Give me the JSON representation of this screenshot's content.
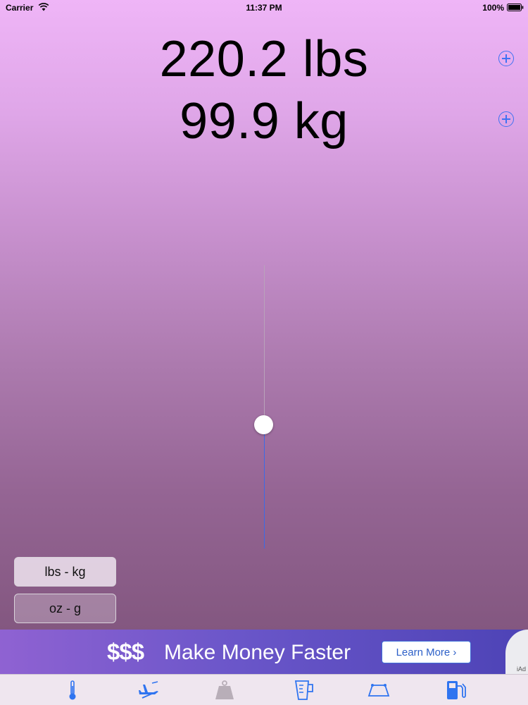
{
  "status_bar": {
    "carrier": "Carrier",
    "time": "11:37 PM",
    "battery": "100%"
  },
  "display": {
    "primary_value": "220.2 lbs",
    "secondary_value": "99.9 kg"
  },
  "slider": {
    "level_fraction": 0.43
  },
  "unit_buttons": {
    "lbs_kg": "lbs - kg",
    "oz_g": "oz - g"
  },
  "ad": {
    "logo": "$$$",
    "headline": "Make Money Faster",
    "cta": "Learn More ›",
    "label": "iAd"
  },
  "tab_bar": {
    "icons": [
      "thermometer-icon",
      "airplane-icon",
      "weight-icon",
      "measuring-cup-icon",
      "area-icon",
      "fuel-pump-icon"
    ],
    "selected": "weight-icon",
    "accent": "#2f74f0",
    "inactive": "#b8aeb8"
  },
  "colors": {
    "accent": "#3f72f2",
    "slider_fill": "#3c6be6",
    "ad_gradient_start": "#8f62d2",
    "ad_gradient_end": "#4d43b6"
  }
}
